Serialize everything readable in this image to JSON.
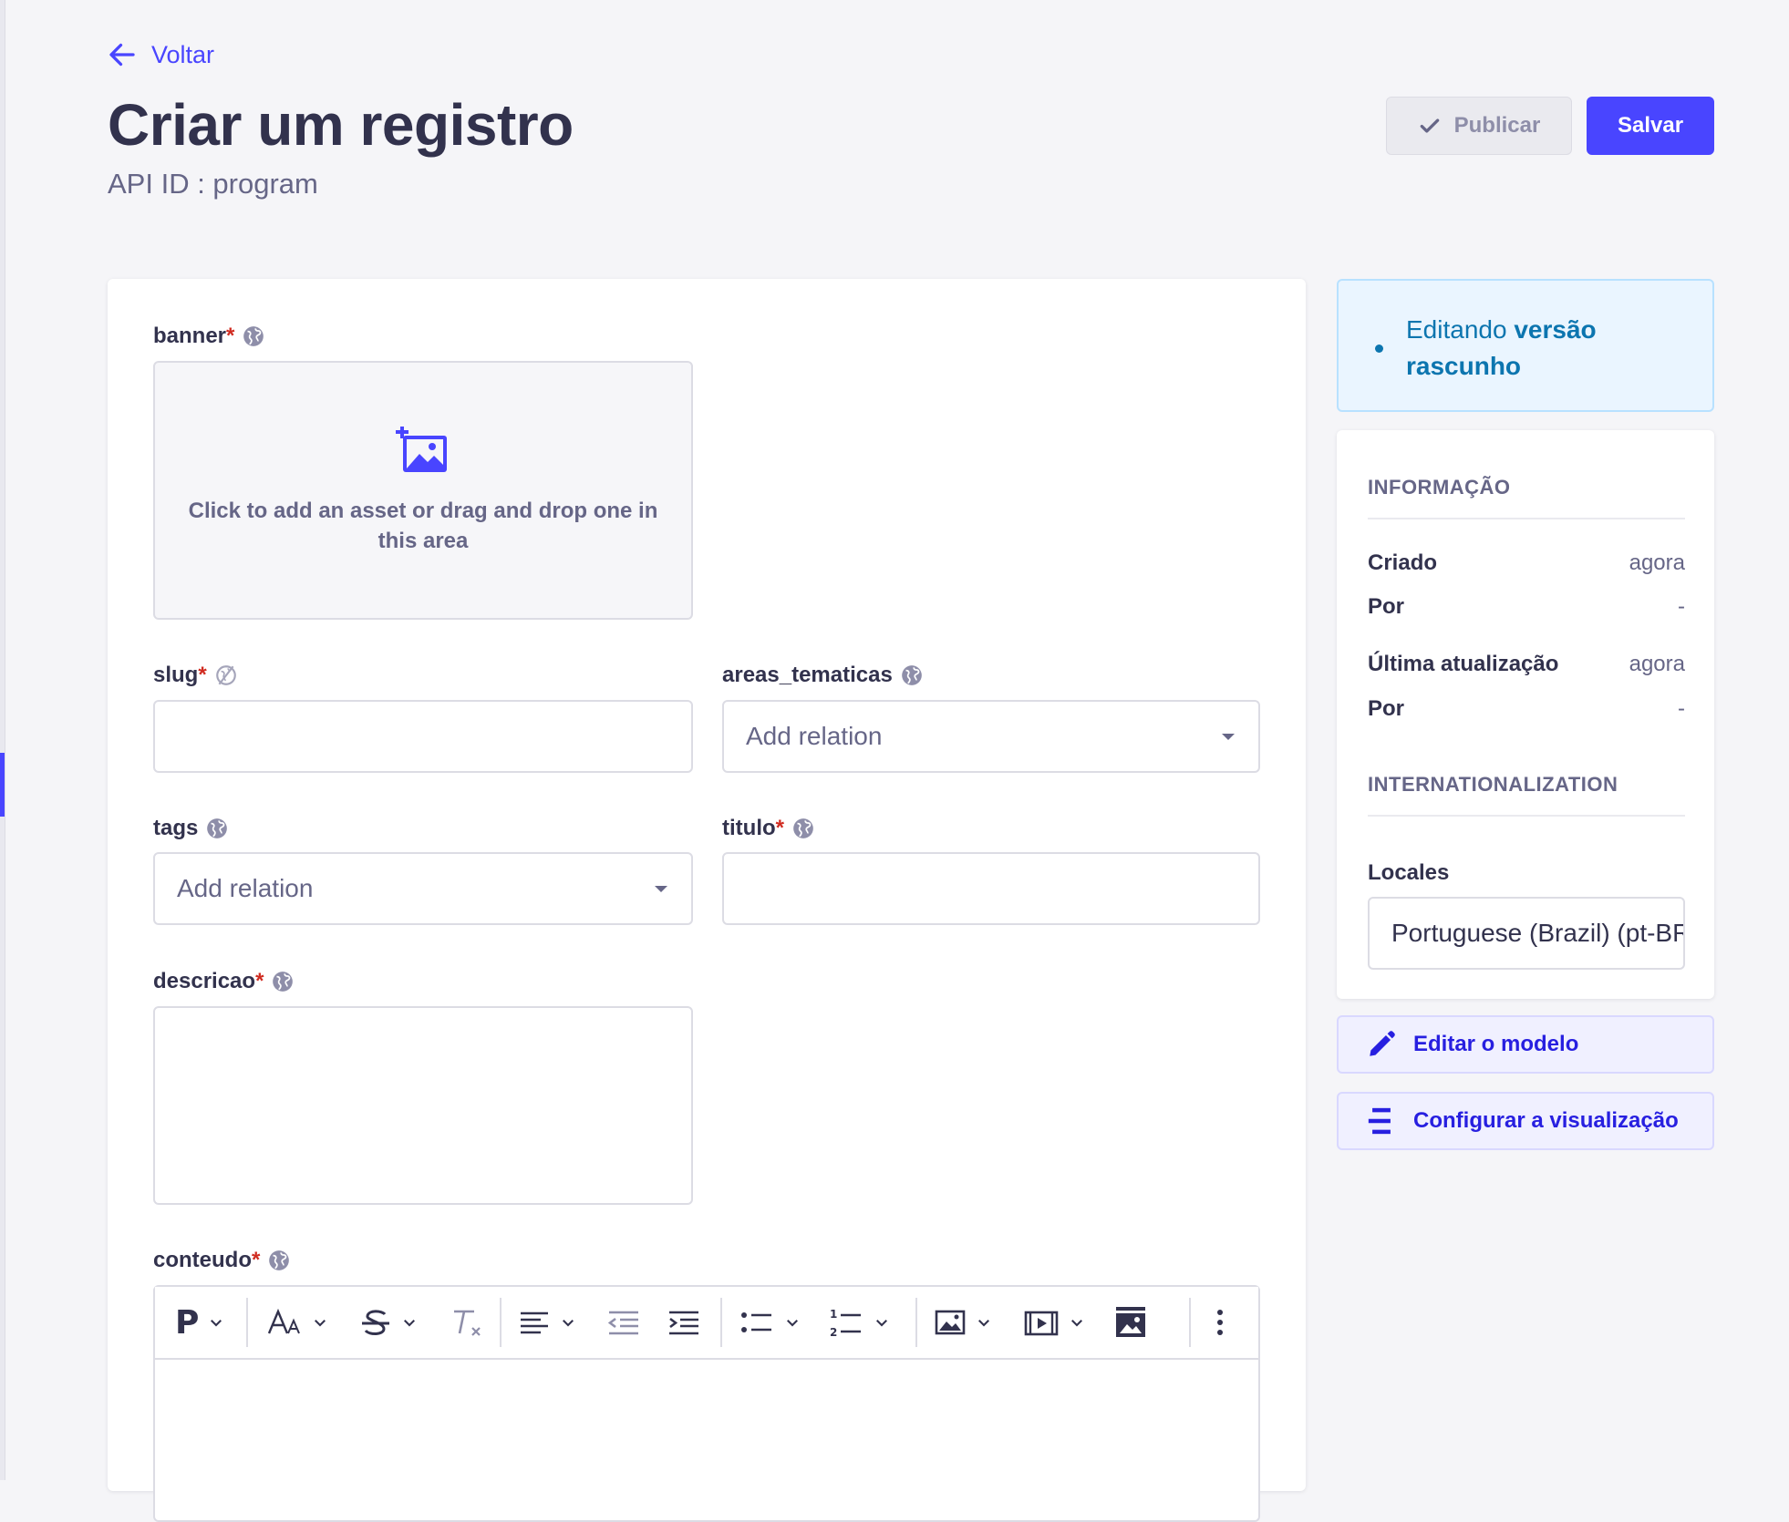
{
  "header": {
    "back_label": "Voltar",
    "title": "Criar um registro",
    "api_id": "API ID : program",
    "publish_label": "Publicar",
    "save_label": "Salvar"
  },
  "form": {
    "banner": {
      "label": "banner",
      "required": "*",
      "dropzone_text": "Click to add an asset or drag and drop one in this area"
    },
    "slug": {
      "label": "slug",
      "required": "*",
      "value": ""
    },
    "areas_tematicas": {
      "label": "areas_tematicas",
      "placeholder": "Add relation"
    },
    "tags": {
      "label": "tags",
      "placeholder": "Add relation"
    },
    "titulo": {
      "label": "titulo",
      "required": "*",
      "value": ""
    },
    "descricao": {
      "label": "descricao",
      "required": "*",
      "value": ""
    },
    "conteudo": {
      "label": "conteudo",
      "required": "*",
      "toolbar": {
        "paragraph_label": "P"
      }
    }
  },
  "sidebar": {
    "draft_notice_prefix": "Editando",
    "draft_notice_bold": "versão rascunho",
    "information": {
      "title": "INFORMAÇÃO",
      "rows": [
        {
          "label": "Criado",
          "value": "agora"
        },
        {
          "label": "Por",
          "value": "-"
        },
        {
          "label": "Última atualização",
          "value": "agora"
        },
        {
          "label": "Por",
          "value": "-"
        }
      ]
    },
    "internationalization": {
      "title": "INTERNATIONALIZATION",
      "locales_label": "Locales",
      "locale_value": "Portuguese (Brazil) (pt-BR)"
    },
    "edit_model_label": "Editar o modelo",
    "configure_view_label": "Configurar a visualização"
  },
  "colors": {
    "primary": "#4945ff",
    "required": "#d02b20",
    "draft_text": "#0c75af",
    "draft_bg": "#eaf5ff",
    "text_dark": "#32324d",
    "text_muted": "#666687"
  },
  "icons": {
    "back": "arrow-left-icon",
    "publish": "check-icon",
    "globe": "globe-icon",
    "asset": "add-image-icon",
    "edit_model": "pencil-icon",
    "configure_view": "layout-lines-icon"
  }
}
